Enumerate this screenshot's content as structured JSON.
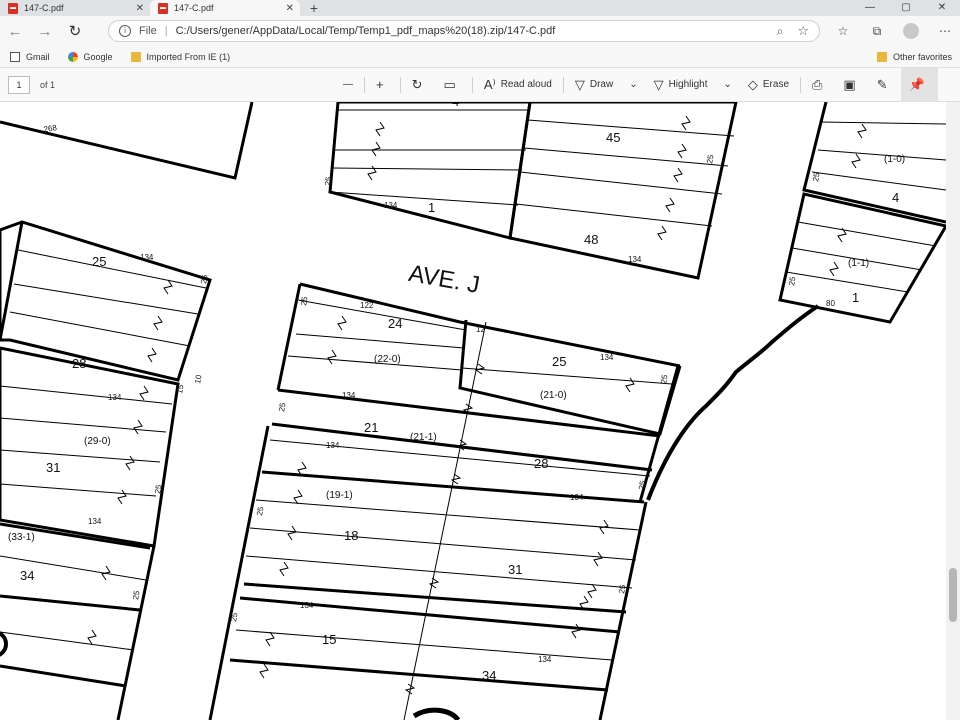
{
  "browser": {
    "tabs": [
      {
        "title": "147-C.pdf",
        "active": false
      },
      {
        "title": "147-C.pdf",
        "active": true
      }
    ],
    "new_tab": "+",
    "window_controls": {
      "minimize": "—",
      "maximize": "▢",
      "close": "✕"
    },
    "address": {
      "scheme_label": "File",
      "url": "C:/Users/gener/AppData/Local/Temp/Temp1_pdf_maps%20(18).zip/147-C.pdf"
    },
    "favorites": [
      {
        "label": "Gmail",
        "icon": "page-icon"
      },
      {
        "label": "Google",
        "icon": "google-icon"
      },
      {
        "label": "Imported From IE (1)",
        "icon": "folder-icon"
      }
    ],
    "other_favorites": "Other favorites"
  },
  "pdf_toolbar": {
    "page_number": "1",
    "page_total": "of 1",
    "zoom_out": "—",
    "zoom_in": "+",
    "read_aloud": "Read aloud",
    "draw": "Draw",
    "highlight": "Highlight",
    "erase": "Erase"
  },
  "map": {
    "street": "AVE.  J",
    "labels": [
      {
        "t": "268",
        "cls": "s"
      },
      {
        "t": "4",
        "cls": "m"
      },
      {
        "t": "45",
        "cls": "m"
      },
      {
        "t": "25",
        "cls": "s"
      },
      {
        "t": "134",
        "cls": "s"
      },
      {
        "t": "1",
        "cls": "m"
      },
      {
        "t": "48",
        "cls": "m"
      },
      {
        "t": "134",
        "cls": "s"
      },
      {
        "t": "25",
        "cls": "s"
      },
      {
        "t": "(1-0)",
        "cls": "p"
      },
      {
        "t": "25",
        "cls": "s"
      },
      {
        "t": "4",
        "cls": "m"
      },
      {
        "t": "(1-1)",
        "cls": "p"
      },
      {
        "t": "25",
        "cls": "s"
      },
      {
        "t": "80",
        "cls": "s"
      },
      {
        "t": "1",
        "cls": "m"
      },
      {
        "t": "25",
        "cls": "m"
      },
      {
        "t": "134",
        "cls": "s"
      },
      {
        "t": "25",
        "cls": "s"
      },
      {
        "t": "28",
        "cls": "m"
      },
      {
        "t": "15",
        "cls": "s"
      },
      {
        "t": "10",
        "cls": "s"
      },
      {
        "t": "134",
        "cls": "s"
      },
      {
        "t": "(29-0)",
        "cls": "p"
      },
      {
        "t": "31",
        "cls": "m"
      },
      {
        "t": "25",
        "cls": "s"
      },
      {
        "t": "134",
        "cls": "s"
      },
      {
        "t": "(33-1)",
        "cls": "p"
      },
      {
        "t": "34",
        "cls": "m"
      },
      {
        "t": "25",
        "cls": "s"
      },
      {
        "t": "25",
        "cls": "s"
      },
      {
        "t": "122",
        "cls": "s"
      },
      {
        "t": "24",
        "cls": "m"
      },
      {
        "t": "12",
        "cls": "s"
      },
      {
        "t": "(22-0)",
        "cls": "p"
      },
      {
        "t": "25",
        "cls": "m"
      },
      {
        "t": "134",
        "cls": "s"
      },
      {
        "t": "(21-0)",
        "cls": "p"
      },
      {
        "t": "25",
        "cls": "s"
      },
      {
        "t": "25",
        "cls": "s"
      },
      {
        "t": "134",
        "cls": "s"
      },
      {
        "t": "21",
        "cls": "m"
      },
      {
        "t": "(21-1)",
        "cls": "p"
      },
      {
        "t": "28",
        "cls": "m"
      },
      {
        "t": "134",
        "cls": "s"
      },
      {
        "t": "25",
        "cls": "s"
      },
      {
        "t": "(19-1)",
        "cls": "p"
      },
      {
        "t": "25",
        "cls": "s"
      },
      {
        "t": "134",
        "cls": "s"
      },
      {
        "t": "18",
        "cls": "m"
      },
      {
        "t": "31",
        "cls": "m"
      },
      {
        "t": "25",
        "cls": "s"
      },
      {
        "t": "134",
        "cls": "s"
      },
      {
        "t": "25",
        "cls": "s"
      },
      {
        "t": "15",
        "cls": "m"
      },
      {
        "t": "134",
        "cls": "s"
      },
      {
        "t": "34",
        "cls": "m"
      }
    ]
  }
}
